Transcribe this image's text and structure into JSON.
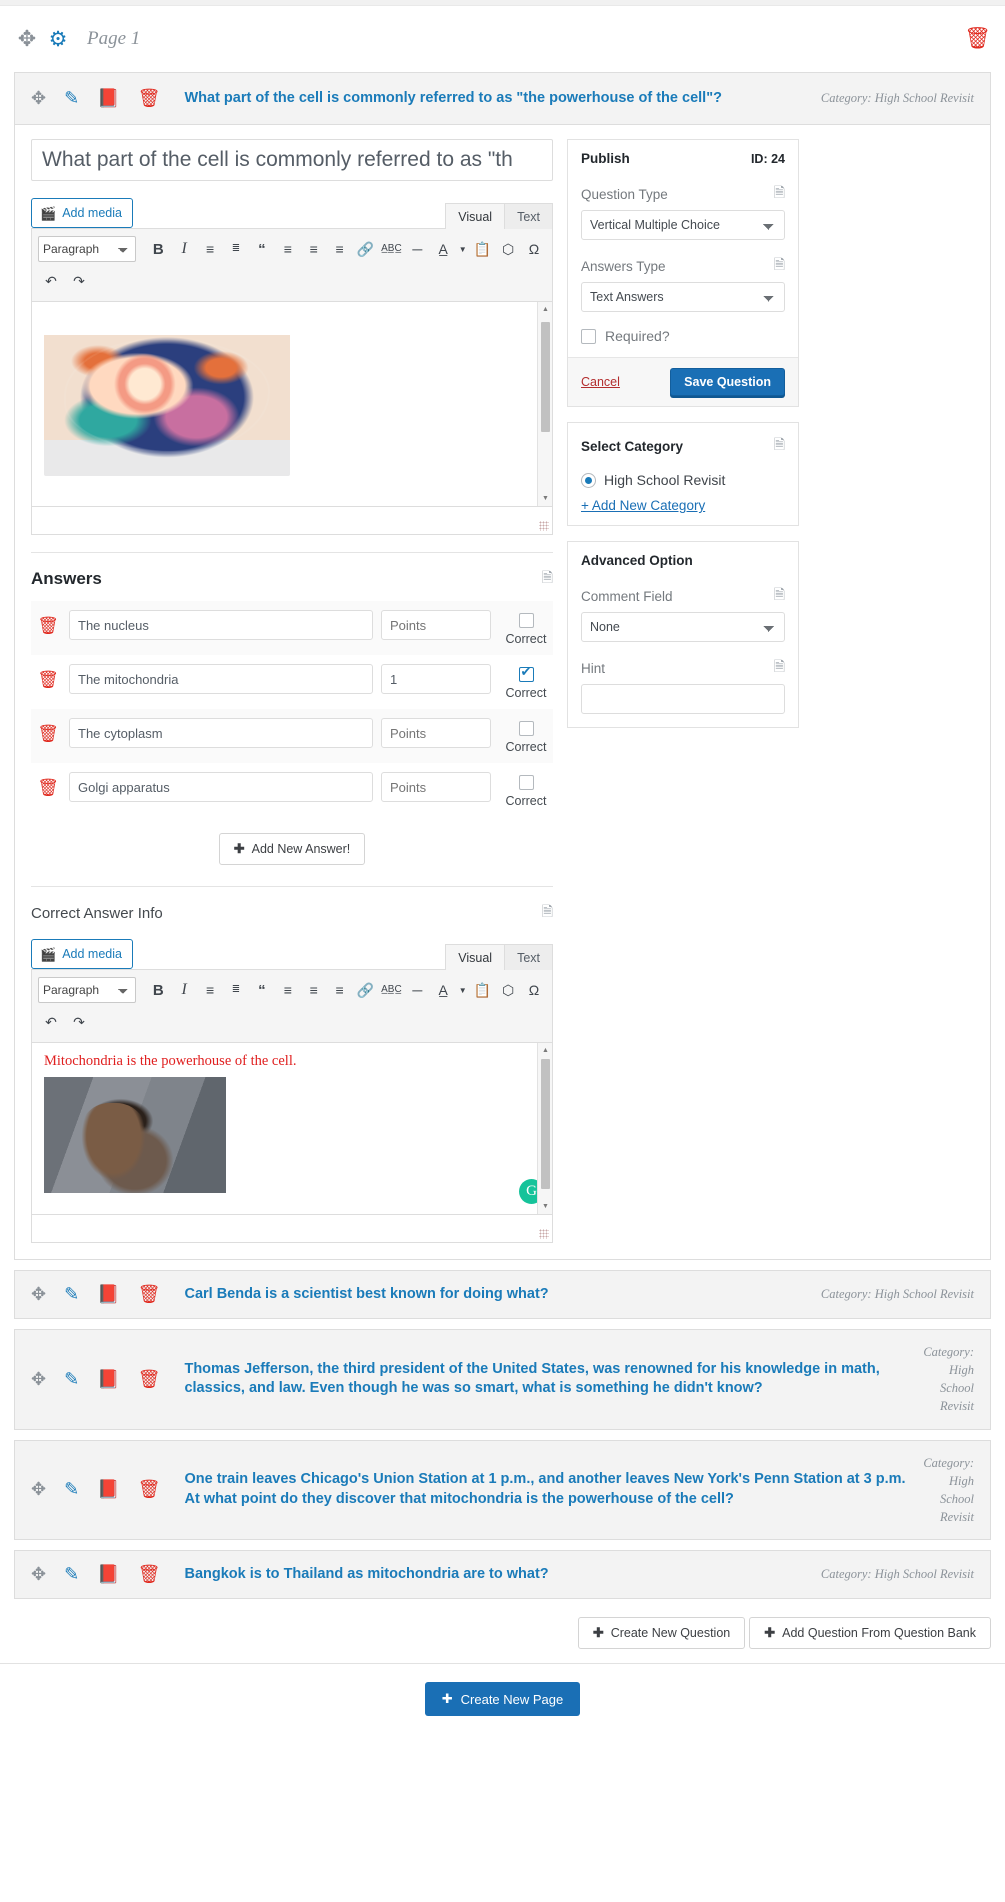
{
  "page": {
    "title": "Page 1",
    "move_icon": "move-arrows-icon",
    "gear_icon": "gear-icon",
    "delete_icon": "trash-icon"
  },
  "open_question": {
    "header": {
      "title": "What part of the cell is commonly referred to as \"the powerhouse of the cell\"?",
      "category": "Category: High School Revisit"
    },
    "title_value": "What part of the cell is commonly referred to as \"th",
    "editor": {
      "add_media_label": "Add media",
      "tab_visual": "Visual",
      "tab_text": "Text",
      "format_select": "Paragraph",
      "bold": "B",
      "italic": "I",
      "bullet_list": "bulleted-list-icon",
      "numbered_list": "numbered-list-icon",
      "blockquote": "“",
      "align_left": "align-left-icon",
      "align_center": "align-center-icon",
      "align_right": "align-right-icon",
      "link": "link-icon",
      "strikethrough": "ABC",
      "horizontal_rule": "—",
      "text_color": "A",
      "paste_text": "paste-icon",
      "clear_format": "eraser-icon",
      "special_char": "Ω",
      "undo": "undo-icon",
      "redo": "redo-icon"
    },
    "answers_section": {
      "title": "Answers",
      "points_placeholder": "Points",
      "correct_label": "Correct",
      "add_new_answer": "Add New Answer!",
      "rows": [
        {
          "text": "The nucleus",
          "points": "",
          "correct": false
        },
        {
          "text": "The mitochondria",
          "points": "1",
          "correct": true
        },
        {
          "text": "The cytoplasm",
          "points": "",
          "correct": false
        },
        {
          "text": "Golgi apparatus",
          "points": "",
          "correct": false
        }
      ]
    },
    "correct_answer_info": {
      "title": "Correct Answer Info",
      "body_text": "Mitochondria is the powerhouse of the cell.",
      "image_name": "roll-safe-think-about-it-meme"
    }
  },
  "sidebar": {
    "publish": {
      "title": "Publish",
      "id_label": "ID: 24",
      "question_type_label": "Question Type",
      "question_type_value": "Vertical Multiple Choice",
      "answers_type_label": "Answers Type",
      "answers_type_value": "Text Answers",
      "required_label": "Required?",
      "required_checked": false,
      "cancel_label": "Cancel",
      "save_label": "Save Question"
    },
    "category": {
      "title": "Select Category",
      "options": [
        {
          "label": "High School Revisit",
          "selected": true
        }
      ],
      "add_new_label": "+ Add New Category"
    },
    "advanced": {
      "title": "Advanced Option",
      "comment_field_label": "Comment Field",
      "comment_field_value": "None",
      "hint_label": "Hint",
      "hint_value": ""
    }
  },
  "collapsed_questions": [
    {
      "title": "Carl Benda is a scientist best known for doing what?",
      "category": "Category: High School Revisit",
      "multiline_cat": false
    },
    {
      "title": "Thomas Jefferson, the third president of the United States, was renowned for his knowledge in math, classics, and law. Even though he was so smart, what is something he didn't know?",
      "category": "Category: High School Revisit",
      "multiline_cat": true
    },
    {
      "title": "One train leaves Chicago's Union Station at 1 p.m., and another leaves New York's Penn Station at 3 p.m. At what point do they discover that mitochondria is the powerhouse of the cell?",
      "category": "Category: High School Revisit",
      "multiline_cat": true
    },
    {
      "title": "Bangkok is to Thailand as mitochondria are to what?",
      "category": "Category: High School Revisit",
      "multiline_cat": false
    }
  ],
  "bottom": {
    "create_new_question": "Create New Question",
    "add_from_bank": "Add Question From Question Bank",
    "create_new_page": "Create New Page"
  },
  "colors": {
    "link_blue": "#1a7bb9",
    "button_blue": "#1a6fb5",
    "danger_red": "#e02b20",
    "note_red": "#e02020",
    "grammarly_green": "#15c39a"
  }
}
